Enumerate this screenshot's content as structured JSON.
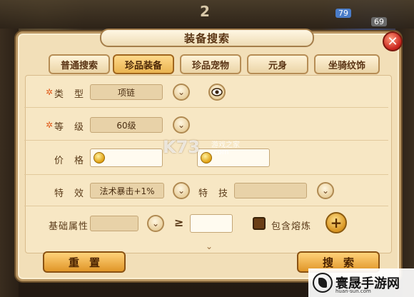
{
  "background": {
    "badge_2": "2",
    "badge_79": "79",
    "badge_69": "69"
  },
  "dialog": {
    "title": "装备搜索",
    "close_label": "✕"
  },
  "tabs": [
    {
      "label": "普通搜索",
      "active": false
    },
    {
      "label": "珍品装备",
      "active": true
    },
    {
      "label": "珍品宠物",
      "active": false
    },
    {
      "label": "元身",
      "active": false
    },
    {
      "label": "坐骑纹饰",
      "active": false
    }
  ],
  "form": {
    "type_label": "类　型",
    "type_value": "项链",
    "level_label": "等　级",
    "level_value": "60级",
    "price_label": "价　格",
    "price_min": "",
    "price_max": "",
    "effect_label": "特　效",
    "effect_value": "法术暴击+1%",
    "skill_label": "特　技",
    "skill_value": "",
    "base_attr_label": "基础属性",
    "base_attr_value": "",
    "geq_symbol": "≥",
    "base_attr_min": "",
    "melt_label": "包含熔炼",
    "required_mark": "✲",
    "dropdown_icon": "⌄",
    "plus_icon": "+",
    "more_icon": "⌄"
  },
  "actions": {
    "reset_label": "重置",
    "search_label": "搜索"
  },
  "watermark": {
    "logo_text": "K73",
    "site_name": "游戏之家",
    "url": ".com",
    "brand_text": "寰晟手游网",
    "brand_url": "huan-sun.com"
  },
  "colors": {
    "panel_bg": "#f2dfb8",
    "tab_active": "#eab450",
    "button": "#e09628",
    "close": "#c8231c"
  }
}
